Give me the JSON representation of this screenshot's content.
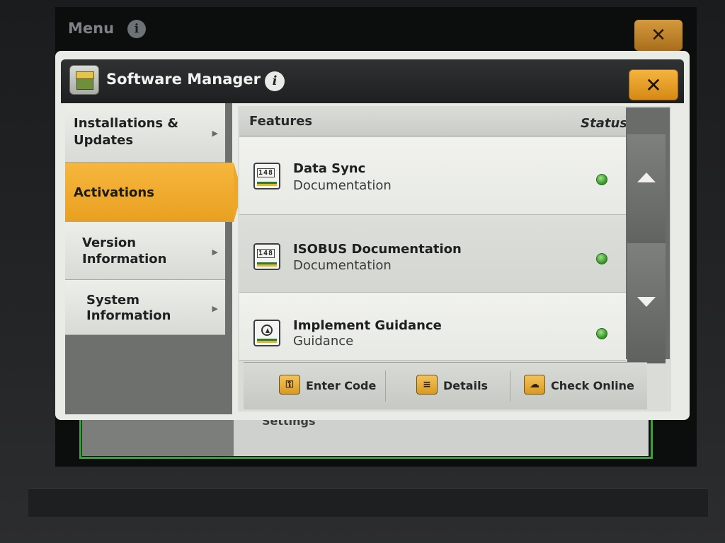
{
  "background": {
    "title": "Menu",
    "info_glyph": "i",
    "close_glyph": "✕",
    "partial_label": "Settings"
  },
  "dialog": {
    "title": "Software Manager",
    "info_glyph": "i",
    "close_glyph": "✕",
    "app_icon": "software-package-icon"
  },
  "nav": {
    "items": [
      {
        "label_line1": "Installations &",
        "label_line2": "Updates",
        "active": false
      },
      {
        "label_line1": "Activations",
        "label_line2": "",
        "active": true
      },
      {
        "label_line1": "Version",
        "label_line2": "Information",
        "active": false
      },
      {
        "label_line1": "System",
        "label_line2": "Information",
        "active": false
      }
    ]
  },
  "features": {
    "header": "Features",
    "status_header": "Status",
    "rows": [
      {
        "name": "Data Sync",
        "category": "Documentation",
        "icon": "documentation-counter-icon",
        "icon_text": "148",
        "status": "active"
      },
      {
        "name": "ISOBUS Documentation",
        "category": "Documentation",
        "icon": "documentation-counter-icon",
        "icon_text": "148",
        "status": "active"
      },
      {
        "name": "Implement Guidance",
        "category": "Guidance",
        "icon": "guidance-icon",
        "icon_text": "",
        "status": "active"
      }
    ]
  },
  "toolbar": {
    "enter_code": "Enter Code",
    "details": "Details",
    "check_online": "Check Online"
  },
  "colors": {
    "accent": "#F0A92C",
    "status_green": "#3D9D2E",
    "header_dark": "#2F3133"
  }
}
